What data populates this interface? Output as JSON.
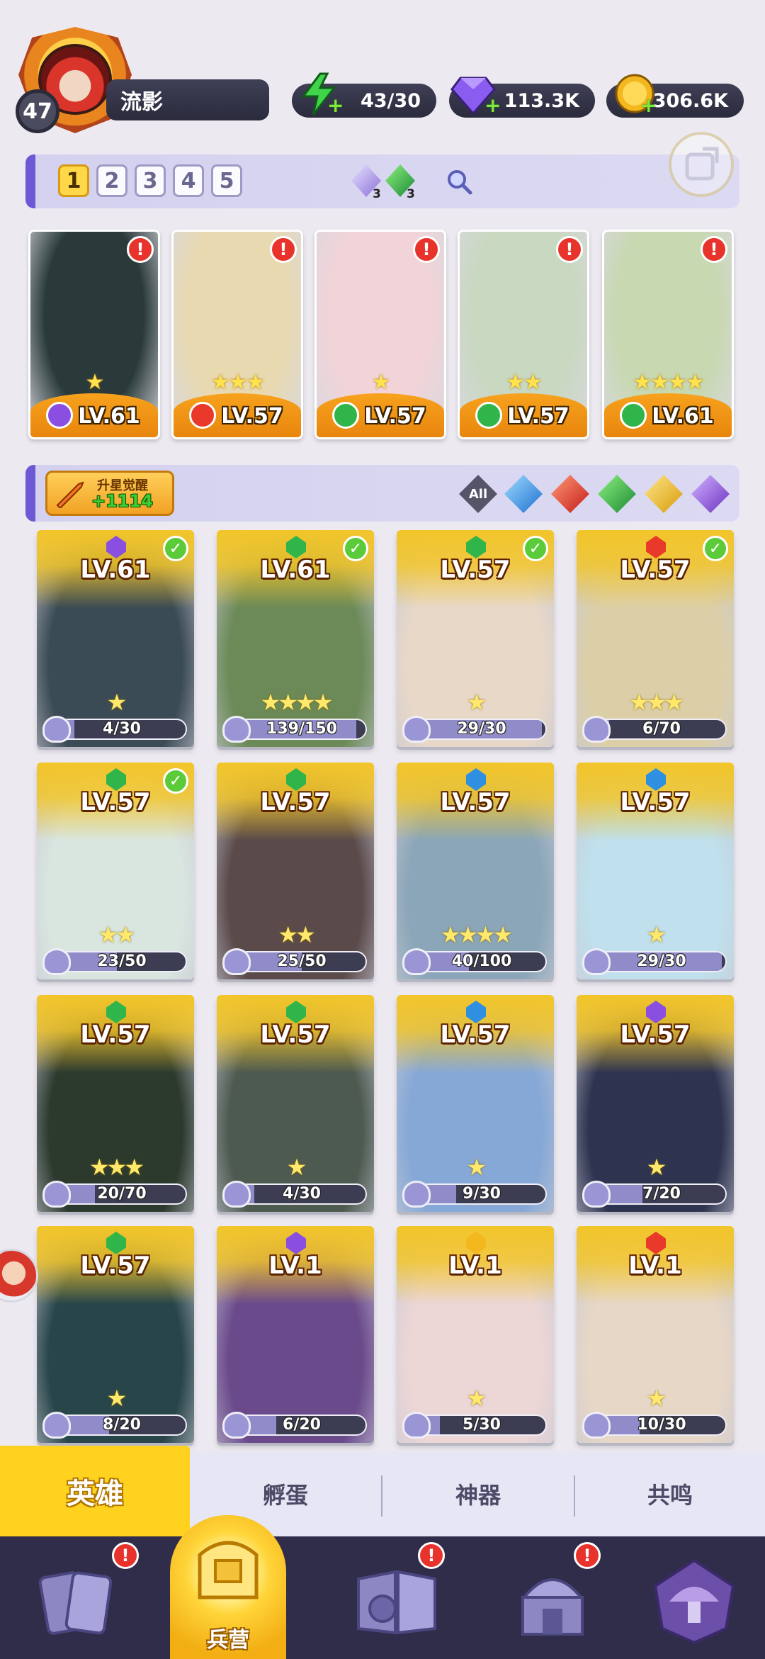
{
  "player": {
    "level": "47",
    "name": "流影"
  },
  "resources": [
    {
      "icon": "energy-icon",
      "value": "43/30",
      "color": "#3fd44a"
    },
    {
      "icon": "gem-icon",
      "value": "113.3K",
      "color": "#8a5cf0"
    },
    {
      "icon": "coin-icon",
      "value": "306.6K",
      "color": "#f3b81f"
    }
  ],
  "team_tabs": [
    "1",
    "2",
    "3",
    "4",
    "5"
  ],
  "team_counts": {
    "purple": "3",
    "green": "3"
  },
  "team": [
    {
      "level": "LV.61",
      "element": "dark",
      "stars": 1,
      "bg": "#2a3a3a"
    },
    {
      "level": "LV.57",
      "element": "fire",
      "stars": 3,
      "bg": "#e9d9b0"
    },
    {
      "level": "LV.57",
      "element": "wind",
      "stars": 1,
      "bg": "#f2d4d8"
    },
    {
      "level": "LV.57",
      "element": "wind",
      "stars": 2,
      "bg": "#c9d8c0"
    },
    {
      "level": "LV.61",
      "element": "wind",
      "stars": 4,
      "bg": "#c8d8b0"
    }
  ],
  "roster": {
    "awaken_label": "升星觉醒",
    "awaken_value": "+1114",
    "filter_all": "All"
  },
  "heroes": [
    {
      "level": "LV.61",
      "element": "dark",
      "shards": "4/30",
      "fill": 0.13,
      "stars": 1,
      "check": true,
      "bg": "#3b4b55"
    },
    {
      "level": "LV.61",
      "element": "wind",
      "shards": "139/150",
      "fill": 0.93,
      "stars": 4,
      "check": true,
      "bg": "#6b8a58"
    },
    {
      "level": "LV.57",
      "element": "wind",
      "shards": "29/30",
      "fill": 0.97,
      "stars": 1,
      "check": true,
      "bg": "#e8d8c8"
    },
    {
      "level": "LV.57",
      "element": "fire",
      "shards": "6/70",
      "fill": 0.09,
      "stars": 3,
      "check": true,
      "bg": "#dccfa8"
    },
    {
      "level": "LV.57",
      "element": "wind",
      "shards": "23/50",
      "fill": 0.46,
      "stars": 2,
      "check": true,
      "bg": "#d9e6e0"
    },
    {
      "level": "LV.57",
      "element": "wind",
      "shards": "25/50",
      "fill": 0.5,
      "stars": 2,
      "check": false,
      "bg": "#5a4a4a"
    },
    {
      "level": "LV.57",
      "element": "water",
      "shards": "40/100",
      "fill": 0.4,
      "stars": 4,
      "check": false,
      "bg": "#8aa6b8"
    },
    {
      "level": "LV.57",
      "element": "water",
      "shards": "29/30",
      "fill": 0.97,
      "stars": 1,
      "check": false,
      "bg": "#bfe0ec"
    },
    {
      "level": "LV.57",
      "element": "wind",
      "shards": "20/70",
      "fill": 0.29,
      "stars": 3,
      "check": false,
      "bg": "#2c3a2e"
    },
    {
      "level": "LV.57",
      "element": "wind",
      "shards": "4/30",
      "fill": 0.13,
      "stars": 1,
      "check": false,
      "bg": "#4d5a50"
    },
    {
      "level": "LV.57",
      "element": "water",
      "shards": "9/30",
      "fill": 0.3,
      "stars": 1,
      "check": false,
      "bg": "#86a8d6"
    },
    {
      "level": "LV.57",
      "element": "dark",
      "shards": "7/20",
      "fill": 0.35,
      "stars": 1,
      "check": false,
      "bg": "#2e3450"
    },
    {
      "level": "LV.57",
      "element": "wind",
      "shards": "8/20",
      "fill": 0.4,
      "stars": 1,
      "check": false,
      "bg": "#28464a"
    },
    {
      "level": "LV.1",
      "element": "dark",
      "shards": "6/20",
      "fill": 0.3,
      "stars": 0,
      "check": false,
      "bg": "#6b4a8c"
    },
    {
      "level": "LV.1",
      "element": "light",
      "shards": "5/30",
      "fill": 0.17,
      "stars": 1,
      "check": false,
      "bg": "#ecd6d6"
    },
    {
      "level": "LV.1",
      "element": "fire",
      "shards": "10/30",
      "fill": 0.33,
      "stars": 1,
      "check": false,
      "bg": "#e7d7c6"
    }
  ],
  "element_colors": {
    "dark": "#8a4fe0",
    "fire": "#e8392a",
    "wind": "#2fb54a",
    "water": "#2f8fe0",
    "light": "#f2b81d"
  },
  "subtabs": [
    "英雄",
    "孵蛋",
    "神器",
    "共鸣"
  ],
  "bottom_nav": {
    "barracks_label": "兵营"
  }
}
